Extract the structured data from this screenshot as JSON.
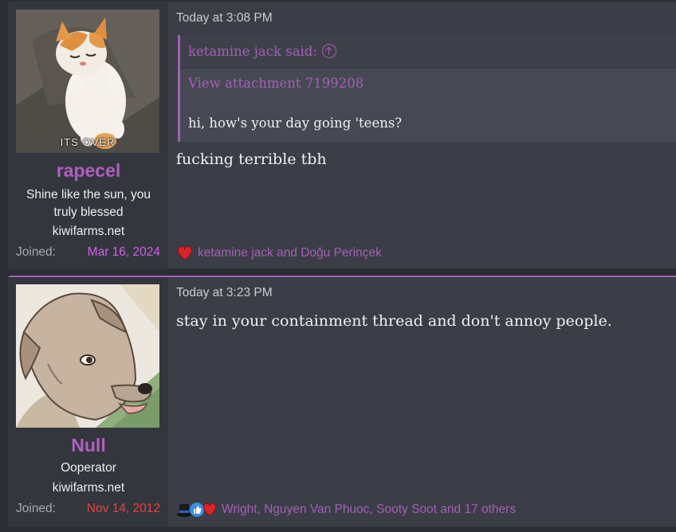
{
  "posts": [
    {
      "avatar_caption": "ITS OVER",
      "username": "rapecel",
      "user_title": "Shine like the sun, you truly blessed",
      "user_banner": "kiwifarms.net",
      "joined_label": "Joined:",
      "joined_date": "Mar 16, 2024",
      "joined_date_color": "#d45fe8",
      "timestamp": "Today at 3:08 PM",
      "quote": {
        "author": "ketamine jack said:",
        "attachment": "View attachment 7199208",
        "text": "hi, how's your day going 'teens?"
      },
      "body": "fucking terrible tbh",
      "reaction_icons": [
        "heart-icon"
      ],
      "reaction_names": "ketamine jack and Doğu Perinçek"
    },
    {
      "avatar_caption": "",
      "username": "Null",
      "user_title": "Ooperator",
      "user_banner": "kiwifarms.net",
      "joined_label": "Joined:",
      "joined_date": "Nov 14, 2012",
      "joined_date_color": "#e8423f",
      "timestamp": "Today at 3:23 PM",
      "body": "stay in your containment thread and don't annoy people.",
      "reaction_icons": [
        "top-hat-icon",
        "thumbs-up-icon",
        "heart-icon"
      ],
      "reaction_names": "Wright, Nguyen Van Phuoc, Sooty Soot and 17 others"
    }
  ],
  "colors": {
    "accent": "#a35fb8",
    "page_bg": "#2a2d33",
    "post_bg": "#3b3e46",
    "user_col_bg": "#33363d"
  }
}
